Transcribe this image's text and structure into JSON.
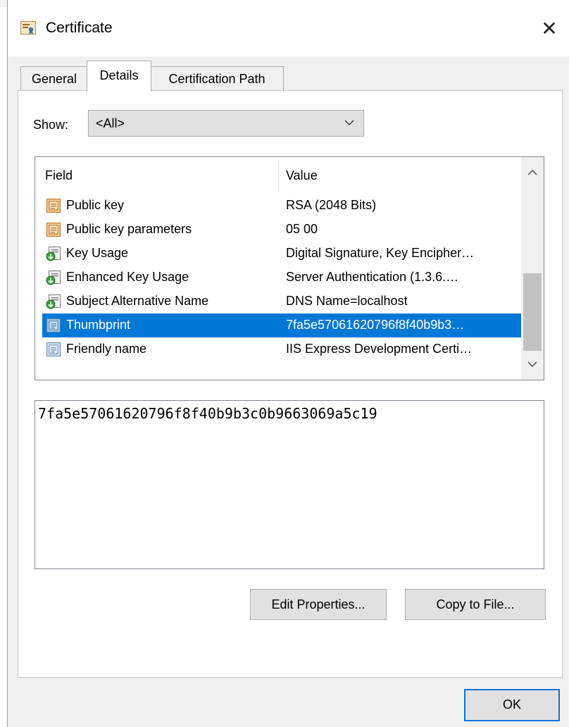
{
  "window": {
    "title": "Certificate"
  },
  "tabs": [
    {
      "label": "General"
    },
    {
      "label": "Details"
    },
    {
      "label": "Certification Path"
    }
  ],
  "show": {
    "label": "Show:",
    "selected": "<All>"
  },
  "table": {
    "columns": [
      "Field",
      "Value"
    ],
    "rows": [
      {
        "field": "Public key",
        "value": "RSA (2048 Bits)",
        "icon": "certificate-field-icon"
      },
      {
        "field": "Public key parameters",
        "value": "05 00",
        "icon": "certificate-field-icon"
      },
      {
        "field": "Key Usage",
        "value": "Digital Signature, Key Encipher…",
        "icon": "extension-critical-icon"
      },
      {
        "field": "Enhanced Key Usage",
        "value": "Server Authentication (1.3.6.…",
        "icon": "extension-critical-icon"
      },
      {
        "field": "Subject Alternative Name",
        "value": "DNS Name=localhost",
        "icon": "extension-icon"
      },
      {
        "field": "Thumbprint",
        "value": "7fa5e57061620796f8f40b9b3…",
        "icon": "property-icon",
        "selected": true
      },
      {
        "field": "Friendly name",
        "value": "IIS Express Development Certi…",
        "icon": "property-icon"
      }
    ]
  },
  "detail_value": "7fa5e57061620796f8f40b9b3c0b9663069a5c19",
  "buttons": {
    "edit_properties": "Edit Properties...",
    "copy_to_file": "Copy to File...",
    "ok": "OK"
  },
  "colors": {
    "selection": "#0078d7",
    "field_icon": "#d9a35a",
    "property_icon": "#7fa7c9"
  }
}
